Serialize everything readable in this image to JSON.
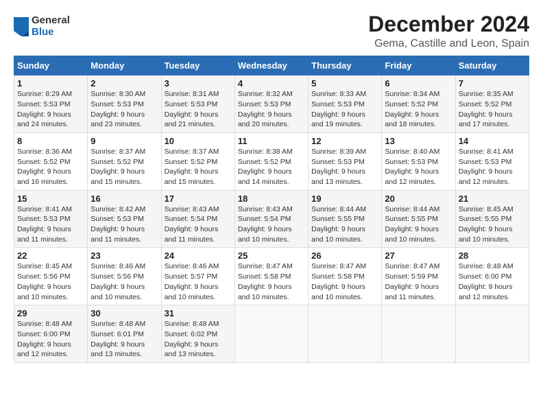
{
  "logo": {
    "general": "General",
    "blue": "Blue"
  },
  "title": "December 2024",
  "subtitle": "Gema, Castille and Leon, Spain",
  "days_of_week": [
    "Sunday",
    "Monday",
    "Tuesday",
    "Wednesday",
    "Thursday",
    "Friday",
    "Saturday"
  ],
  "weeks": [
    [
      {
        "day": "1",
        "sunrise": "Sunrise: 8:29 AM",
        "sunset": "Sunset: 5:53 PM",
        "daylight": "Daylight: 9 hours and 24 minutes."
      },
      {
        "day": "2",
        "sunrise": "Sunrise: 8:30 AM",
        "sunset": "Sunset: 5:53 PM",
        "daylight": "Daylight: 9 hours and 23 minutes."
      },
      {
        "day": "3",
        "sunrise": "Sunrise: 8:31 AM",
        "sunset": "Sunset: 5:53 PM",
        "daylight": "Daylight: 9 hours and 21 minutes."
      },
      {
        "day": "4",
        "sunrise": "Sunrise: 8:32 AM",
        "sunset": "Sunset: 5:53 PM",
        "daylight": "Daylight: 9 hours and 20 minutes."
      },
      {
        "day": "5",
        "sunrise": "Sunrise: 8:33 AM",
        "sunset": "Sunset: 5:53 PM",
        "daylight": "Daylight: 9 hours and 19 minutes."
      },
      {
        "day": "6",
        "sunrise": "Sunrise: 8:34 AM",
        "sunset": "Sunset: 5:52 PM",
        "daylight": "Daylight: 9 hours and 18 minutes."
      },
      {
        "day": "7",
        "sunrise": "Sunrise: 8:35 AM",
        "sunset": "Sunset: 5:52 PM",
        "daylight": "Daylight: 9 hours and 17 minutes."
      }
    ],
    [
      {
        "day": "8",
        "sunrise": "Sunrise: 8:36 AM",
        "sunset": "Sunset: 5:52 PM",
        "daylight": "Daylight: 9 hours and 16 minutes."
      },
      {
        "day": "9",
        "sunrise": "Sunrise: 8:37 AM",
        "sunset": "Sunset: 5:52 PM",
        "daylight": "Daylight: 9 hours and 15 minutes."
      },
      {
        "day": "10",
        "sunrise": "Sunrise: 8:37 AM",
        "sunset": "Sunset: 5:52 PM",
        "daylight": "Daylight: 9 hours and 15 minutes."
      },
      {
        "day": "11",
        "sunrise": "Sunrise: 8:38 AM",
        "sunset": "Sunset: 5:52 PM",
        "daylight": "Daylight: 9 hours and 14 minutes."
      },
      {
        "day": "12",
        "sunrise": "Sunrise: 8:39 AM",
        "sunset": "Sunset: 5:53 PM",
        "daylight": "Daylight: 9 hours and 13 minutes."
      },
      {
        "day": "13",
        "sunrise": "Sunrise: 8:40 AM",
        "sunset": "Sunset: 5:53 PM",
        "daylight": "Daylight: 9 hours and 12 minutes."
      },
      {
        "day": "14",
        "sunrise": "Sunrise: 8:41 AM",
        "sunset": "Sunset: 5:53 PM",
        "daylight": "Daylight: 9 hours and 12 minutes."
      }
    ],
    [
      {
        "day": "15",
        "sunrise": "Sunrise: 8:41 AM",
        "sunset": "Sunset: 5:53 PM",
        "daylight": "Daylight: 9 hours and 11 minutes."
      },
      {
        "day": "16",
        "sunrise": "Sunrise: 8:42 AM",
        "sunset": "Sunset: 5:53 PM",
        "daylight": "Daylight: 9 hours and 11 minutes."
      },
      {
        "day": "17",
        "sunrise": "Sunrise: 8:43 AM",
        "sunset": "Sunset: 5:54 PM",
        "daylight": "Daylight: 9 hours and 11 minutes."
      },
      {
        "day": "18",
        "sunrise": "Sunrise: 8:43 AM",
        "sunset": "Sunset: 5:54 PM",
        "daylight": "Daylight: 9 hours and 10 minutes."
      },
      {
        "day": "19",
        "sunrise": "Sunrise: 8:44 AM",
        "sunset": "Sunset: 5:55 PM",
        "daylight": "Daylight: 9 hours and 10 minutes."
      },
      {
        "day": "20",
        "sunrise": "Sunrise: 8:44 AM",
        "sunset": "Sunset: 5:55 PM",
        "daylight": "Daylight: 9 hours and 10 minutes."
      },
      {
        "day": "21",
        "sunrise": "Sunrise: 8:45 AM",
        "sunset": "Sunset: 5:55 PM",
        "daylight": "Daylight: 9 hours and 10 minutes."
      }
    ],
    [
      {
        "day": "22",
        "sunrise": "Sunrise: 8:45 AM",
        "sunset": "Sunset: 5:56 PM",
        "daylight": "Daylight: 9 hours and 10 minutes."
      },
      {
        "day": "23",
        "sunrise": "Sunrise: 8:46 AM",
        "sunset": "Sunset: 5:56 PM",
        "daylight": "Daylight: 9 hours and 10 minutes."
      },
      {
        "day": "24",
        "sunrise": "Sunrise: 8:46 AM",
        "sunset": "Sunset: 5:57 PM",
        "daylight": "Daylight: 9 hours and 10 minutes."
      },
      {
        "day": "25",
        "sunrise": "Sunrise: 8:47 AM",
        "sunset": "Sunset: 5:58 PM",
        "daylight": "Daylight: 9 hours and 10 minutes."
      },
      {
        "day": "26",
        "sunrise": "Sunrise: 8:47 AM",
        "sunset": "Sunset: 5:58 PM",
        "daylight": "Daylight: 9 hours and 10 minutes."
      },
      {
        "day": "27",
        "sunrise": "Sunrise: 8:47 AM",
        "sunset": "Sunset: 5:59 PM",
        "daylight": "Daylight: 9 hours and 11 minutes."
      },
      {
        "day": "28",
        "sunrise": "Sunrise: 8:48 AM",
        "sunset": "Sunset: 6:00 PM",
        "daylight": "Daylight: 9 hours and 12 minutes."
      }
    ],
    [
      {
        "day": "29",
        "sunrise": "Sunrise: 8:48 AM",
        "sunset": "Sunset: 6:00 PM",
        "daylight": "Daylight: 9 hours and 12 minutes."
      },
      {
        "day": "30",
        "sunrise": "Sunrise: 8:48 AM",
        "sunset": "Sunset: 6:01 PM",
        "daylight": "Daylight: 9 hours and 13 minutes."
      },
      {
        "day": "31",
        "sunrise": "Sunrise: 8:48 AM",
        "sunset": "Sunset: 6:02 PM",
        "daylight": "Daylight: 9 hours and 13 minutes."
      },
      null,
      null,
      null,
      null
    ]
  ]
}
